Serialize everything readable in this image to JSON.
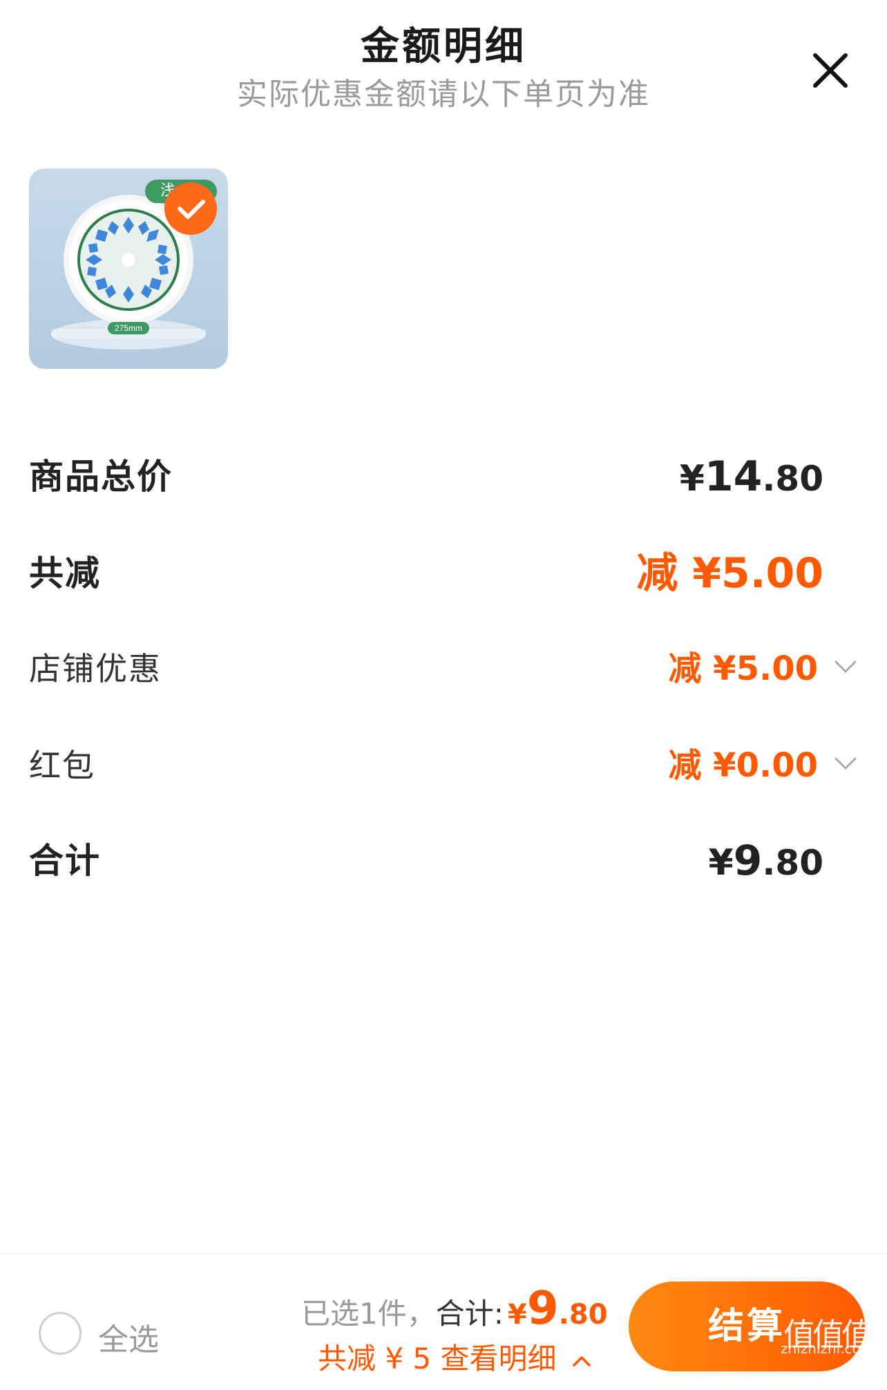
{
  "header": {
    "title": "金额明细",
    "subtitle": "实际优惠金额请以下单页为准",
    "close_icon": "close-icon"
  },
  "product": {
    "tag_text": "浅",
    "size_label": "275mm",
    "selected": true,
    "check_icon": "checkmark-icon"
  },
  "rows": {
    "total_price": {
      "label": "商品总价",
      "yen": "¥",
      "int": "14",
      "dec": ".80"
    },
    "total_discount": {
      "label": "共减",
      "value": "减 ¥5.00"
    },
    "shop_discount": {
      "label": "店铺优惠",
      "value": "减 ¥5.00",
      "icon": "chevron-down-icon"
    },
    "red_packet": {
      "label": "红包",
      "value": "减 ¥0.00",
      "icon": "chevron-down-icon"
    },
    "grand_total": {
      "label": "合计",
      "yen": "¥",
      "int": "9",
      "dec": ".80"
    }
  },
  "bottom_bar": {
    "select_all_label": "全选",
    "selected_count": "已选1件，",
    "sum_label": "合计:",
    "sum_yen": "¥",
    "sum_int": "9",
    "sum_dec": ".80",
    "detail_text": "共减 ¥ 5  查看明细",
    "detail_icon": "chevron-up-icon",
    "checkout_label": "结算"
  },
  "watermark": {
    "text": "zhizhizhi.com",
    "glyphs": "值值值"
  },
  "colors": {
    "accent": "#ff5a00",
    "text": "#222222",
    "muted": "#9a9a9a"
  }
}
